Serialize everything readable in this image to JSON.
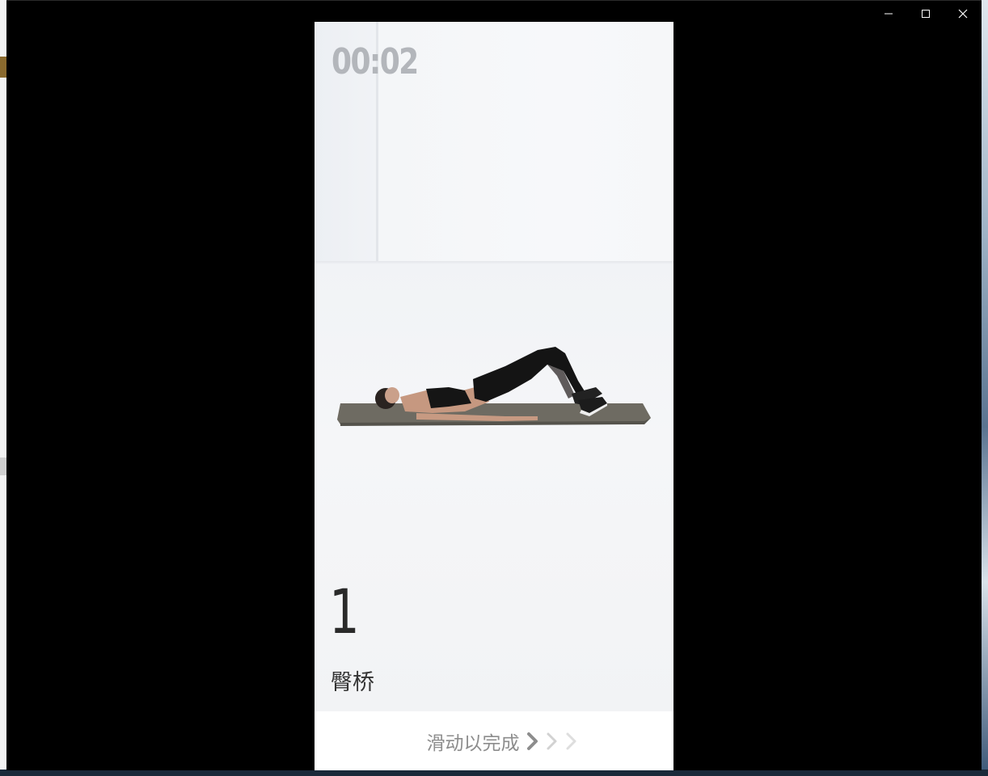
{
  "window": {
    "minimize_icon": "minimize-icon",
    "maximize_icon": "maximize-icon",
    "close_icon": "close-icon"
  },
  "workout": {
    "timer": "00:02",
    "rep_count": "1",
    "exercise_name": "臀桥",
    "swipe_label": "滑动以完成",
    "chevron_icon": "chevron-right-icon"
  },
  "colors": {
    "timer": "#b3b6bb",
    "text_dark": "#2a2a2a",
    "swipe_text": "#8d8d8d",
    "mat": "#6e6b62"
  }
}
